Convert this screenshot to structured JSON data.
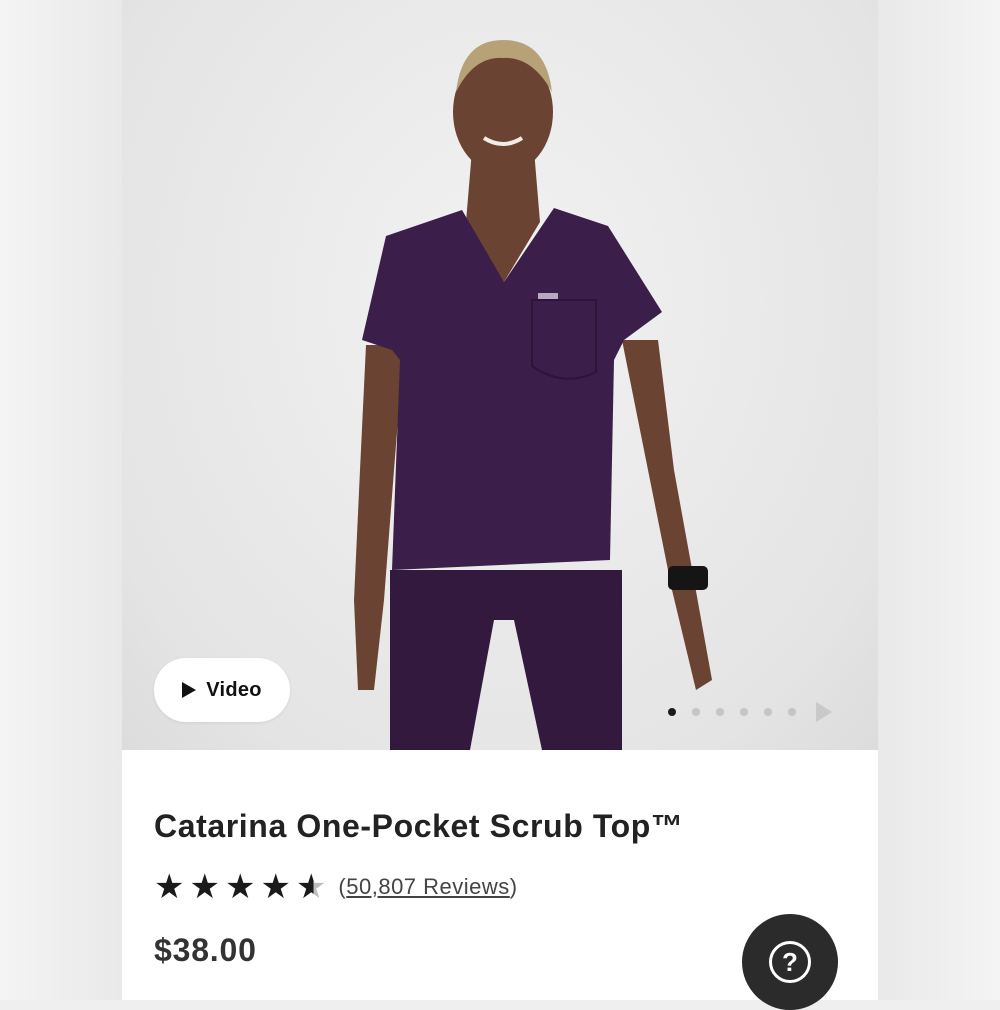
{
  "product": {
    "title": "Catarina One-Pocket Scrub Top™",
    "rating": 4.6,
    "stars_max": 5,
    "reviews_open": "(",
    "reviews_link": "50,807 Reviews",
    "reviews_close": ")",
    "price": "$38.00",
    "color": "#3b1f4a"
  },
  "gallery": {
    "video_label": "Video",
    "total_images": 6,
    "current_index": 0
  },
  "icons": {
    "play": "play-icon",
    "next": "chevron-right-icon",
    "help": "question-mark-icon",
    "star": "star-icon"
  },
  "help": {
    "glyph": "?"
  }
}
